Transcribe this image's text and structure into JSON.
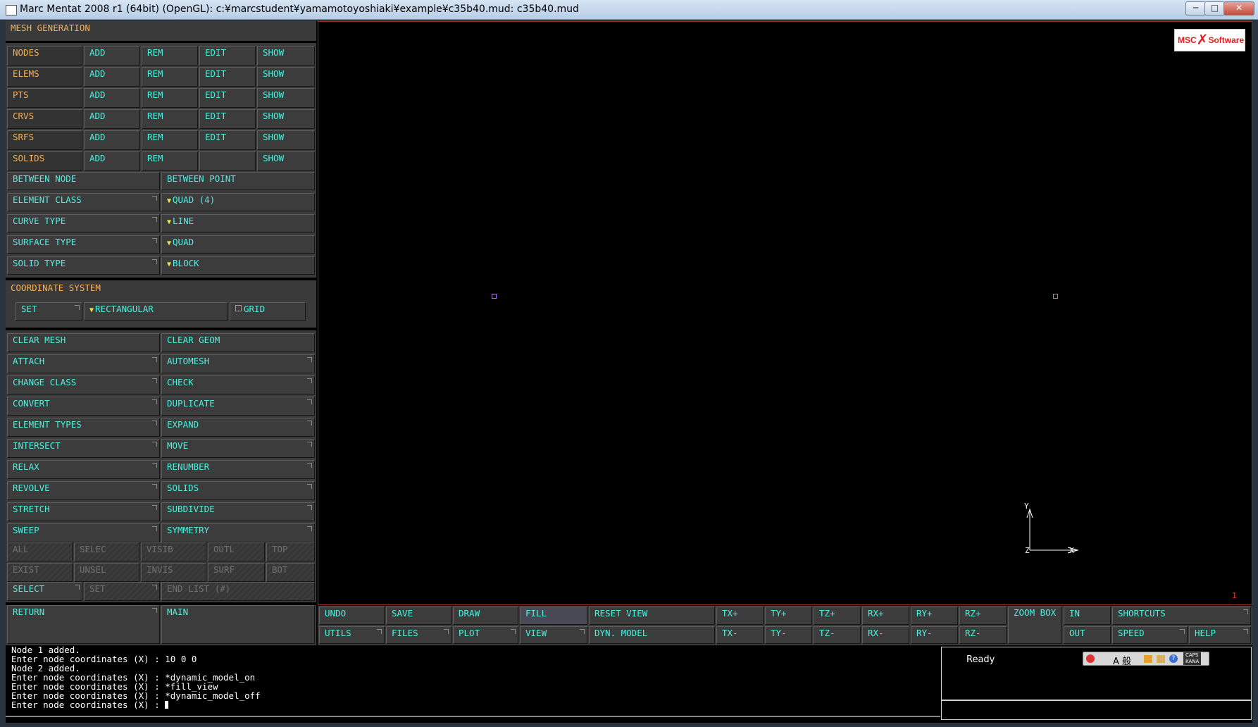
{
  "window": {
    "title": "Marc Mentat 2008 r1 (64bit) (OpenGL): c:¥marcstudent¥yamamotoyoshiaki¥example¥c35b40.mud: c35b40.mud",
    "min_glyph": "─",
    "max_glyph": "□",
    "close_glyph": "✕"
  },
  "panel": {
    "title": "MESH GENERATION",
    "entity_rows": [
      {
        "label": "NODES",
        "add": "ADD",
        "rem": "REM",
        "edit": "EDIT",
        "show": "SHOW"
      },
      {
        "label": "ELEMS",
        "add": "ADD",
        "rem": "REM",
        "edit": "EDIT",
        "show": "SHOW"
      },
      {
        "label": "PTS",
        "add": "ADD",
        "rem": "REM",
        "edit": "EDIT",
        "show": "SHOW"
      },
      {
        "label": "CRVS",
        "add": "ADD",
        "rem": "REM",
        "edit": "EDIT",
        "show": "SHOW"
      },
      {
        "label": "SRFS",
        "add": "ADD",
        "rem": "REM",
        "edit": "EDIT",
        "show": "SHOW"
      },
      {
        "label": "SOLIDS",
        "add": "ADD",
        "rem": "REM",
        "edit": "",
        "show": "SHOW"
      }
    ],
    "between_node": "BETWEEN NODE",
    "between_point": "BETWEEN POINT",
    "types": [
      {
        "label": "ELEMENT CLASS",
        "value": "QUAD (4)"
      },
      {
        "label": "CURVE TYPE",
        "value": "LINE"
      },
      {
        "label": "SURFACE TYPE",
        "value": "QUAD"
      },
      {
        "label": "SOLID TYPE",
        "value": "BLOCK"
      }
    ],
    "coord": {
      "title": "COORDINATE SYSTEM",
      "set": "SET",
      "system": "RECTANGULAR",
      "grid": "GRID",
      "grid_on": false
    },
    "ops": [
      [
        "CLEAR MESH",
        "CLEAR GEOM"
      ],
      [
        "ATTACH",
        "AUTOMESH"
      ],
      [
        "CHANGE CLASS",
        "CHECK"
      ],
      [
        "CONVERT",
        "DUPLICATE"
      ],
      [
        "ELEMENT TYPES",
        "EXPAND"
      ],
      [
        "INTERSECT",
        "MOVE"
      ],
      [
        "RELAX",
        "RENUMBER"
      ],
      [
        "REVOLVE",
        "SOLIDS"
      ],
      [
        "STRETCH",
        "SUBDIVIDE"
      ],
      [
        "SWEEP",
        "SYMMETRY"
      ]
    ],
    "select_row1": [
      "ALL",
      "SELEC",
      "VISIB",
      "OUTL",
      "TOP"
    ],
    "select_row2": [
      "EXIST",
      "UNSEL",
      "INVIS",
      "SURF",
      "BOT"
    ],
    "select": "SELECT",
    "set2": "SET",
    "end_list": "END LIST (#)",
    "return": "RETURN",
    "main": "MAIN"
  },
  "viewport": {
    "logo_left": "MSC",
    "logo_right": "Software",
    "axis_x": "X",
    "axis_y": "Y",
    "axis_z": "Z",
    "corner_number": "1",
    "node_color": "#b070ff",
    "frame_color": "#9c2b2b"
  },
  "toolbar": {
    "row1": [
      "UNDO",
      "SAVE",
      "DRAW",
      "FILL",
      "RESET VIEW",
      "TX+",
      "TY+",
      "TZ+",
      "RX+",
      "RY+",
      "RZ+"
    ],
    "row2": [
      "UTILS",
      "FILES",
      "PLOT",
      "VIEW",
      "DYN. MODEL",
      "TX-",
      "TY-",
      "TZ-",
      "RX-",
      "RY-",
      "RZ-"
    ],
    "zoom_box": "ZOOM BOX",
    "in": "IN",
    "out": "OUT",
    "shortcuts": "SHORTCUTS",
    "speed": "SPEED",
    "help": "HELP"
  },
  "console": {
    "lines": [
      "Node 1 added.",
      "Enter node coordinates (X) : 10 0 0",
      "Node 2 added.",
      "Enter node coordinates (X) : *dynamic_model_on",
      "Enter node coordinates (X) : *fill_view",
      "Enter node coordinates (X) : *dynamic_model_off",
      "Enter node coordinates (X) : "
    ]
  },
  "status": {
    "text": "Ready",
    "ime_mode": "A 般",
    "caps": "CAPS",
    "kana": "KANA"
  },
  "colors": {
    "label": "#f0b060",
    "button_text": "#4ff0e0",
    "accent_triangle": "#f4e04d",
    "logo_red": "#e02020"
  }
}
